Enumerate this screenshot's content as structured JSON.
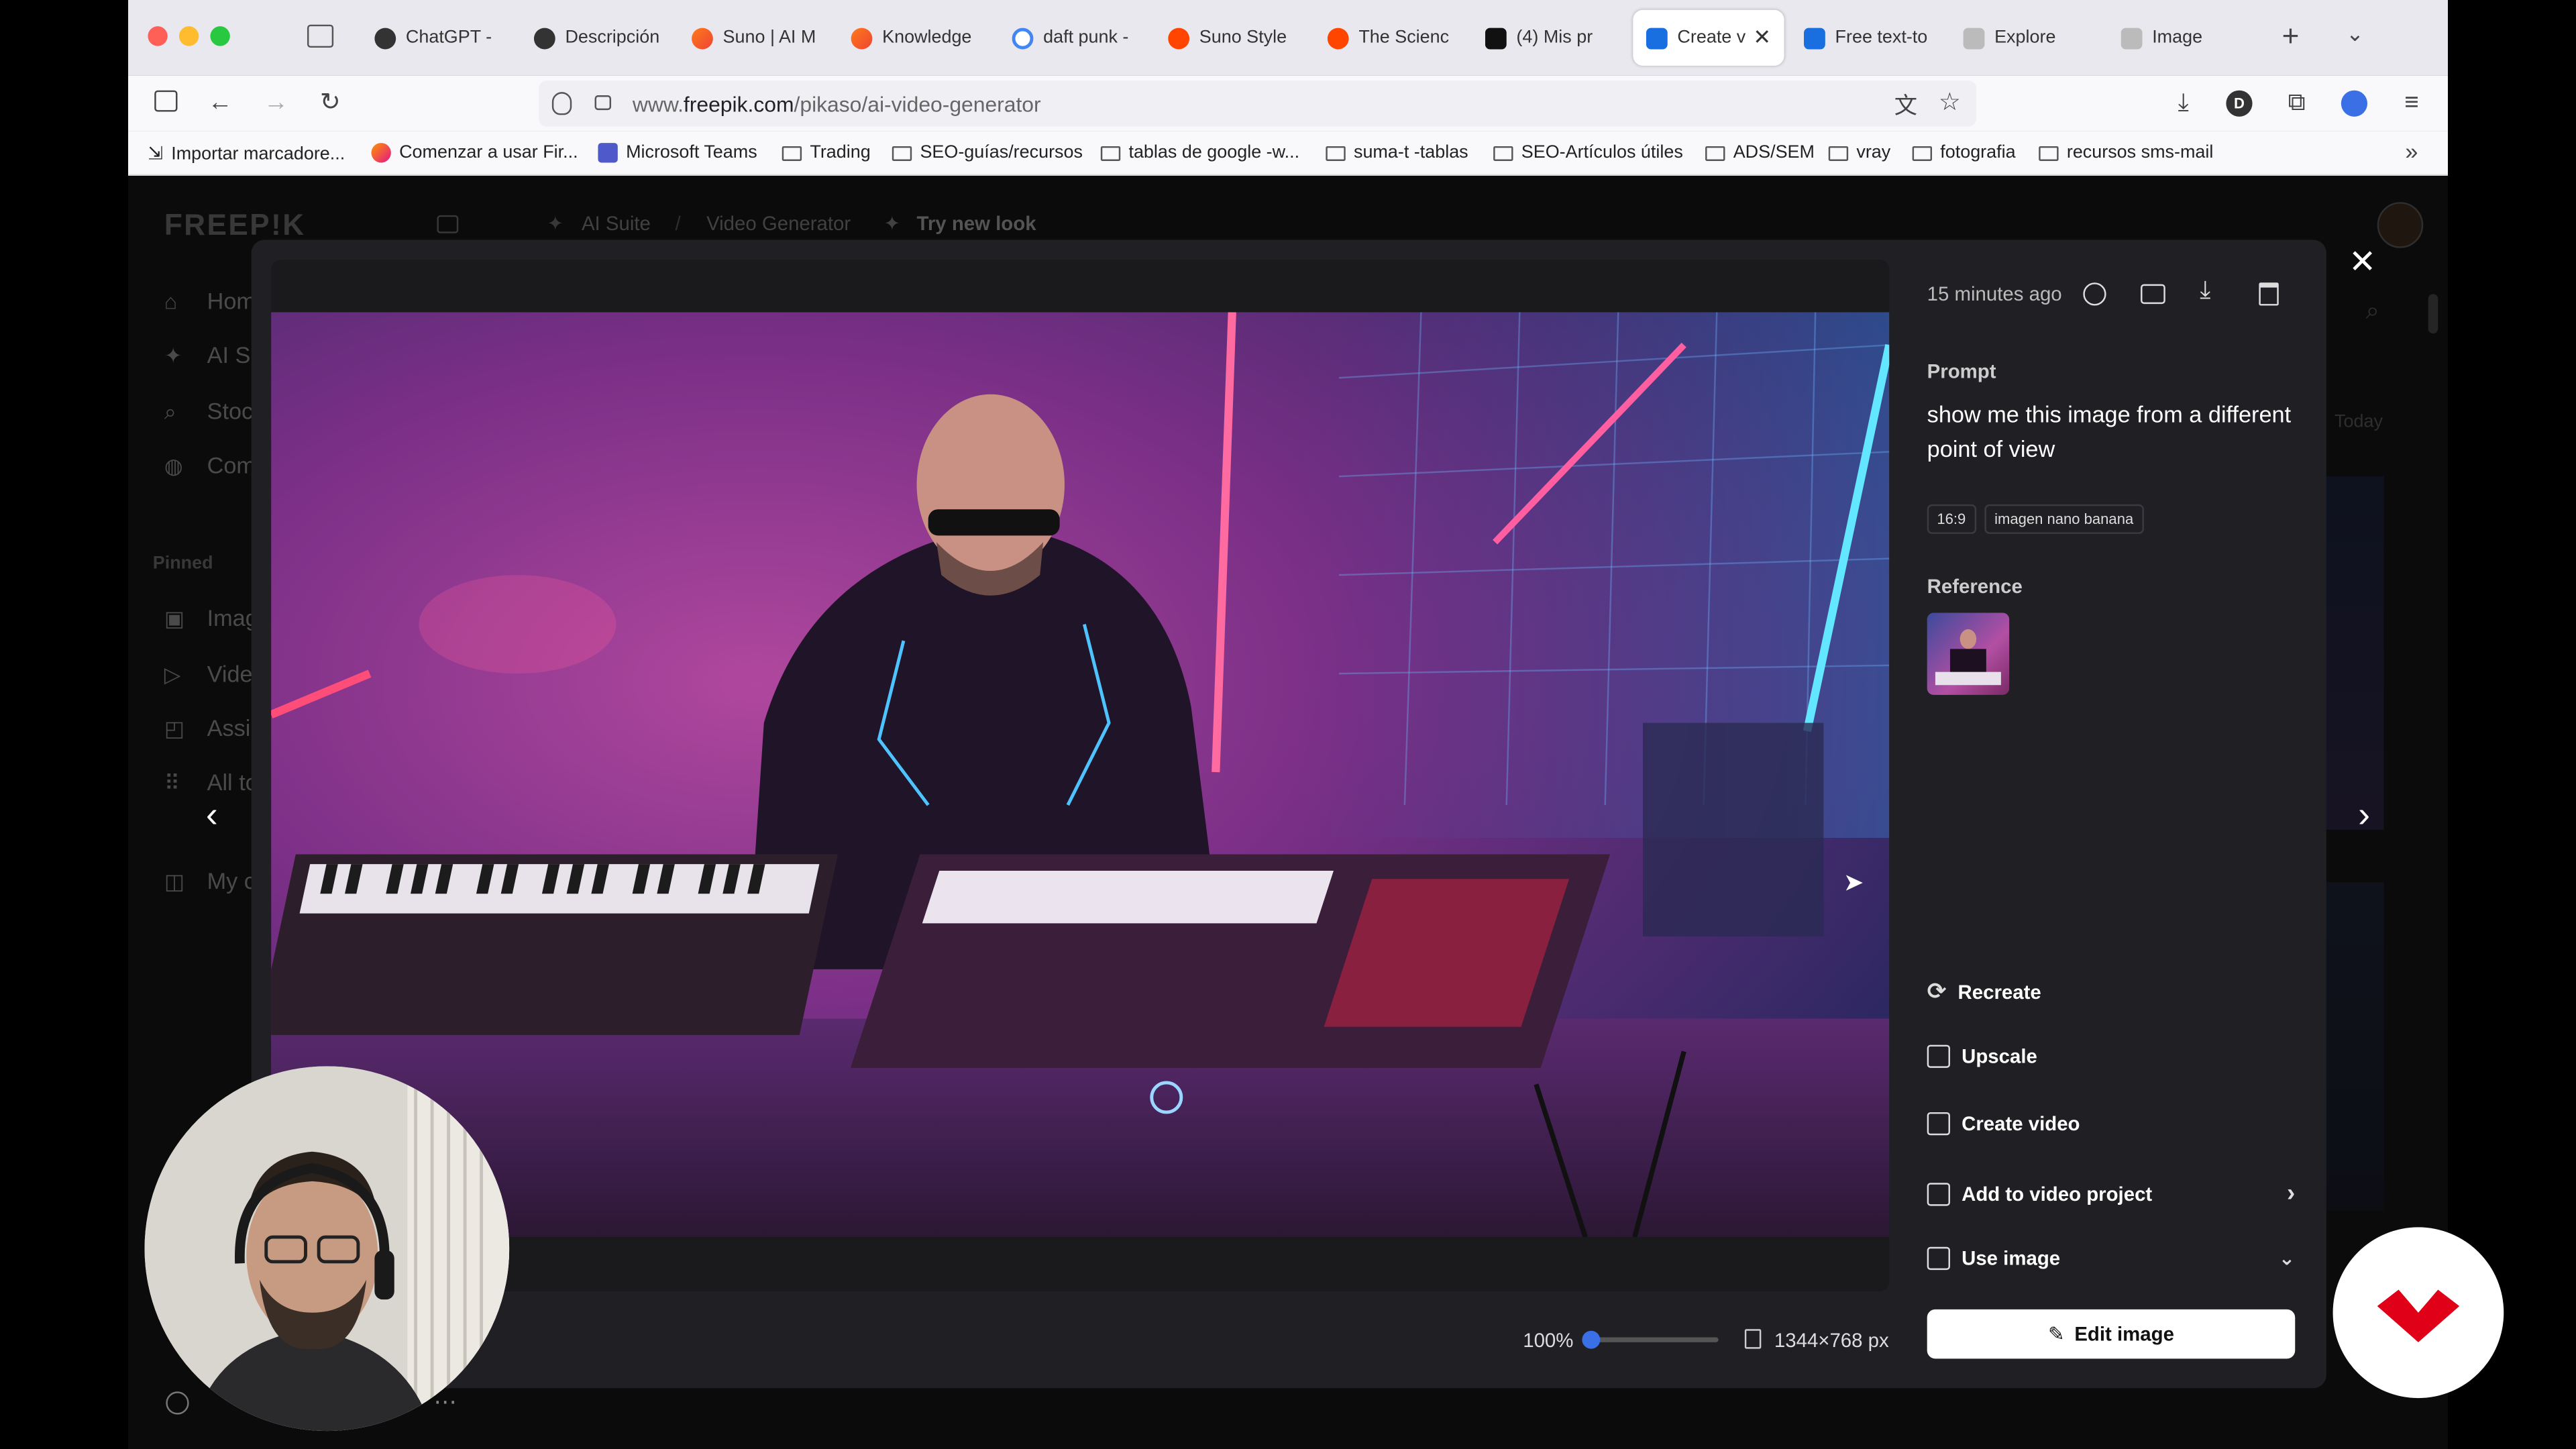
{
  "browser": {
    "tabs": [
      {
        "label": "ChatGPT -",
        "icon": "openai-icon"
      },
      {
        "label": "Descripción",
        "icon": "openai-icon"
      },
      {
        "label": "Suno | AI M",
        "icon": "suno-icon"
      },
      {
        "label": "Knowledge",
        "icon": "suno-icon"
      },
      {
        "label": "daft punk -",
        "icon": "google-icon"
      },
      {
        "label": "Suno Style",
        "icon": "reddit-icon"
      },
      {
        "label": "The Scienc",
        "icon": "reddit-icon"
      },
      {
        "label": "(4)  Mis pr",
        "icon": "app-icon"
      },
      {
        "label": "Create v",
        "icon": "freepik-icon",
        "active": true
      },
      {
        "label": "Free text-to",
        "icon": "freepik-icon"
      },
      {
        "label": "Explore",
        "icon": "explore-icon"
      },
      {
        "label": "Image",
        "icon": "explore-icon"
      }
    ],
    "url_prefix": "www.",
    "url_domain": "freepik.com",
    "url_path": "/pikaso/ai-video-generator",
    "bookmarks": [
      "Importar marcadore...",
      "Comenzar a usar Fir...",
      "Microsoft Teams",
      "Trading",
      "SEO-guías/recursos",
      "tablas de google -w...",
      "suma-t -tablas",
      "SEO-Artículos útiles",
      "ADS/SEM",
      "vray",
      "fotografia",
      "recursos sms-mail"
    ]
  },
  "freepik": {
    "logo": "FREEP!K",
    "breadcrumb_ai": "AI Suite",
    "breadcrumb_sep": "/",
    "breadcrumb_page": "Video Generator",
    "try_new_look": "Try new look",
    "sidebar": {
      "items": [
        "Hom",
        "AI Sı",
        "Stoc",
        "Com"
      ],
      "pinned_label": "Pinned",
      "pinned": [
        "Imag",
        "Vide",
        "Assi",
        "All tc",
        "My c"
      ]
    },
    "bg_today": "Today"
  },
  "modal": {
    "timestamp": "15 minutes ago",
    "prompt_label": "Prompt",
    "prompt_text": "show me this image from a different point of view",
    "tags": [
      "16:9",
      "imagen nano banana"
    ],
    "reference_label": "Reference",
    "actions": {
      "recreate": "Recreate",
      "upscale": "Upscale",
      "create_video": "Create video",
      "add_to_video_project": "Add to video project",
      "use_image": "Use image"
    },
    "edit_button": "Edit image",
    "zoom": "100%",
    "zoom_fraction": 0,
    "dimensions": "1344×768 px"
  },
  "colors": {
    "accent": "#3a6fe6",
    "logo_red": "#e00018"
  }
}
